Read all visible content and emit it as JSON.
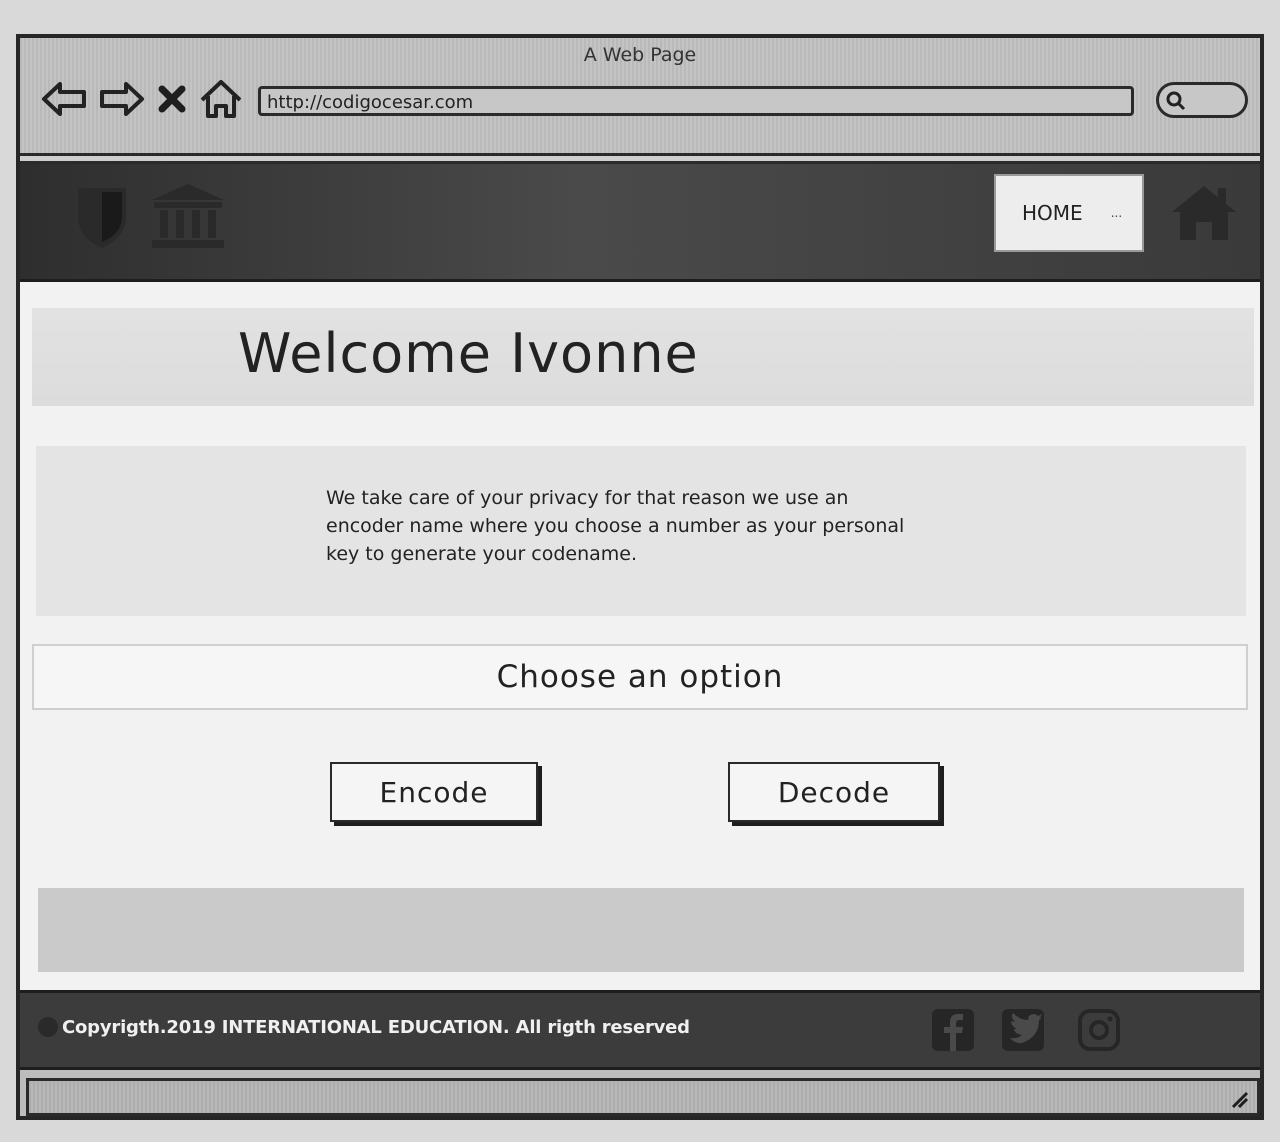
{
  "browser": {
    "window_title": "A Web Page",
    "url": "http://codigocesar.com"
  },
  "header": {
    "nav_home_label": "HOME",
    "nav_more": "..."
  },
  "main": {
    "welcome_title": "Welcome Ivonne",
    "privacy_text": "We take care of your privacy for that reason we use an encoder name where you choose a number as your personal key to generate your codename.",
    "choose_option": "Choose an option",
    "encode_label": "Encode",
    "decode_label": "Decode"
  },
  "footer": {
    "copyright": "Copyrigth.2019 INTERNATIONAL EDUCATION. All rigth reserved"
  },
  "icons": [
    "back-arrow-icon",
    "forward-arrow-icon",
    "close-icon",
    "home-icon",
    "search-icon",
    "shield-icon",
    "bank-icon",
    "house-icon",
    "copyright-icon",
    "facebook-icon",
    "twitter-icon",
    "instagram-icon",
    "resize-grip-icon"
  ]
}
